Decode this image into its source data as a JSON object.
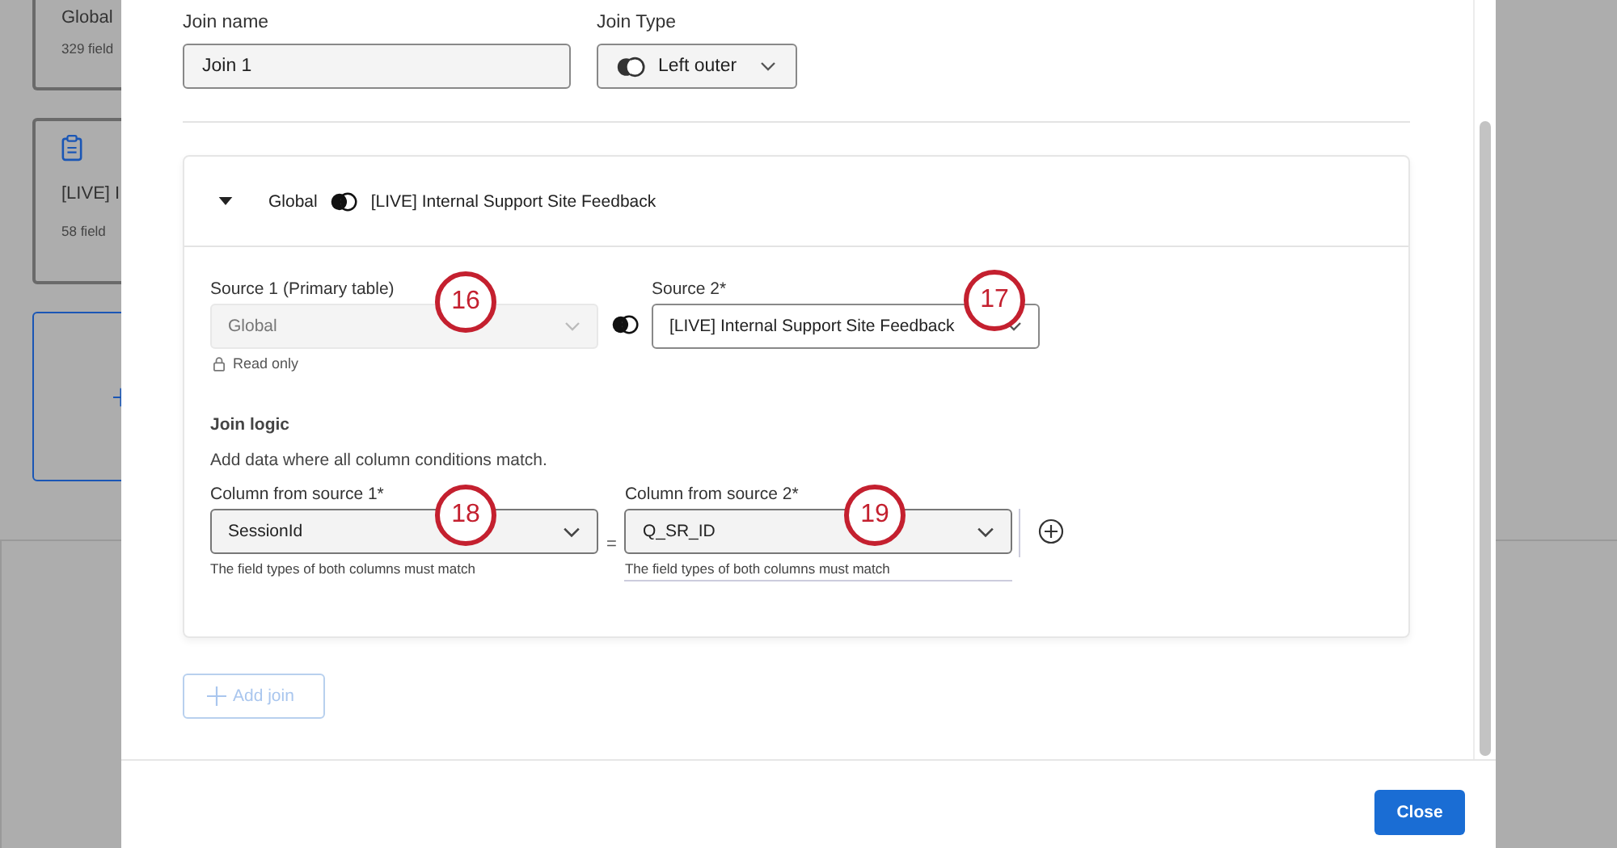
{
  "background": {
    "cards": [
      {
        "kind": "source",
        "title": "Global",
        "subtitle": "329 field"
      },
      {
        "kind": "survey",
        "title": "[LIVE] I",
        "subtitle": "58 field"
      },
      {
        "kind": "add"
      }
    ]
  },
  "dialog": {
    "join_name": {
      "label": "Join name",
      "value": "Join 1"
    },
    "join_type": {
      "label": "Join Type",
      "value": "Left outer"
    },
    "join": {
      "expanded": true,
      "source_1_name": "Global",
      "source_2_name": "[LIVE] Internal Support Site Feedback",
      "source_1": {
        "label": "Source 1 (Primary table)",
        "value": "Global",
        "disabled": true,
        "note": "Read only"
      },
      "source_2": {
        "label": "Source 2*",
        "value": "[LIVE] Internal Support Site Feedback"
      },
      "logic_title": "Join logic",
      "logic_text": "Add data where all column conditions match.",
      "conditions": [
        {
          "left_label": "Column from source 1*",
          "left_value": "SessionId",
          "operator": "=",
          "right_label": "Column from source 2*",
          "right_value": "Q_SR_ID",
          "left_hint": "The field types of both columns must match",
          "right_hint": "The field types of both columns must match"
        }
      ]
    },
    "add_join": {
      "label": "Add join",
      "disabled": true
    },
    "close": "Close"
  },
  "callouts": [
    "16",
    "17",
    "18",
    "19"
  ]
}
